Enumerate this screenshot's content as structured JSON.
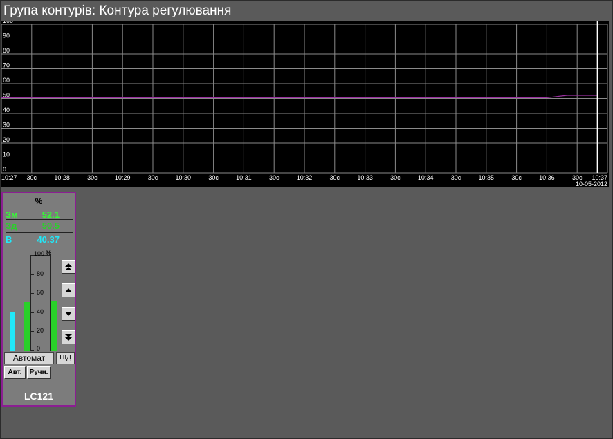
{
  "window": {
    "title": "Група контурів: Контура регулювання"
  },
  "chart_data": {
    "type": "line",
    "y_ticks": [
      "100",
      "90",
      "80",
      "70",
      "60",
      "50",
      "40",
      "30",
      "20",
      "10",
      "0"
    ],
    "ylim": [
      0,
      100
    ],
    "x_ticks": [
      "10:27",
      "30c",
      "10:28",
      "30c",
      "10:29",
      "30c",
      "10:30",
      "30c",
      "10:31",
      "30c",
      "10:32",
      "30c",
      "10:33",
      "30c",
      "10:34",
      "30c",
      "10:35",
      "30c",
      "10:36",
      "30c",
      "10:37"
    ],
    "date": "10-05-2012",
    "grid": true,
    "series": [
      {
        "color": "#9a2fa0",
        "x": [
          "10:27:00",
          "10:36:00",
          "10:36:20",
          "10:36:50"
        ],
        "values": [
          50.5,
          50.5,
          52.1,
          52.1
        ]
      }
    ]
  },
  "faceplate": {
    "unit": "%",
    "pv_label": "Зм",
    "pv_value": "52.1",
    "sp_label": "Зд",
    "sp_value": "50.5",
    "out_label": "В",
    "out_value": "40.37",
    "scale": [
      "100",
      "80",
      "60",
      "40",
      "20",
      "0"
    ],
    "scale_unit": "%",
    "bars": {
      "out": 40.37,
      "sp": 50.5,
      "pv": 52.1
    },
    "mode": "Автомат",
    "pid": "ПІД",
    "auto_button": "Авт.",
    "manual_button": "Ручн.",
    "tag": "LC121",
    "colors": {
      "pv": "#33ff33",
      "sp": "#2ad02a",
      "out": "#22e8f8",
      "border": "#8b1e92"
    }
  }
}
